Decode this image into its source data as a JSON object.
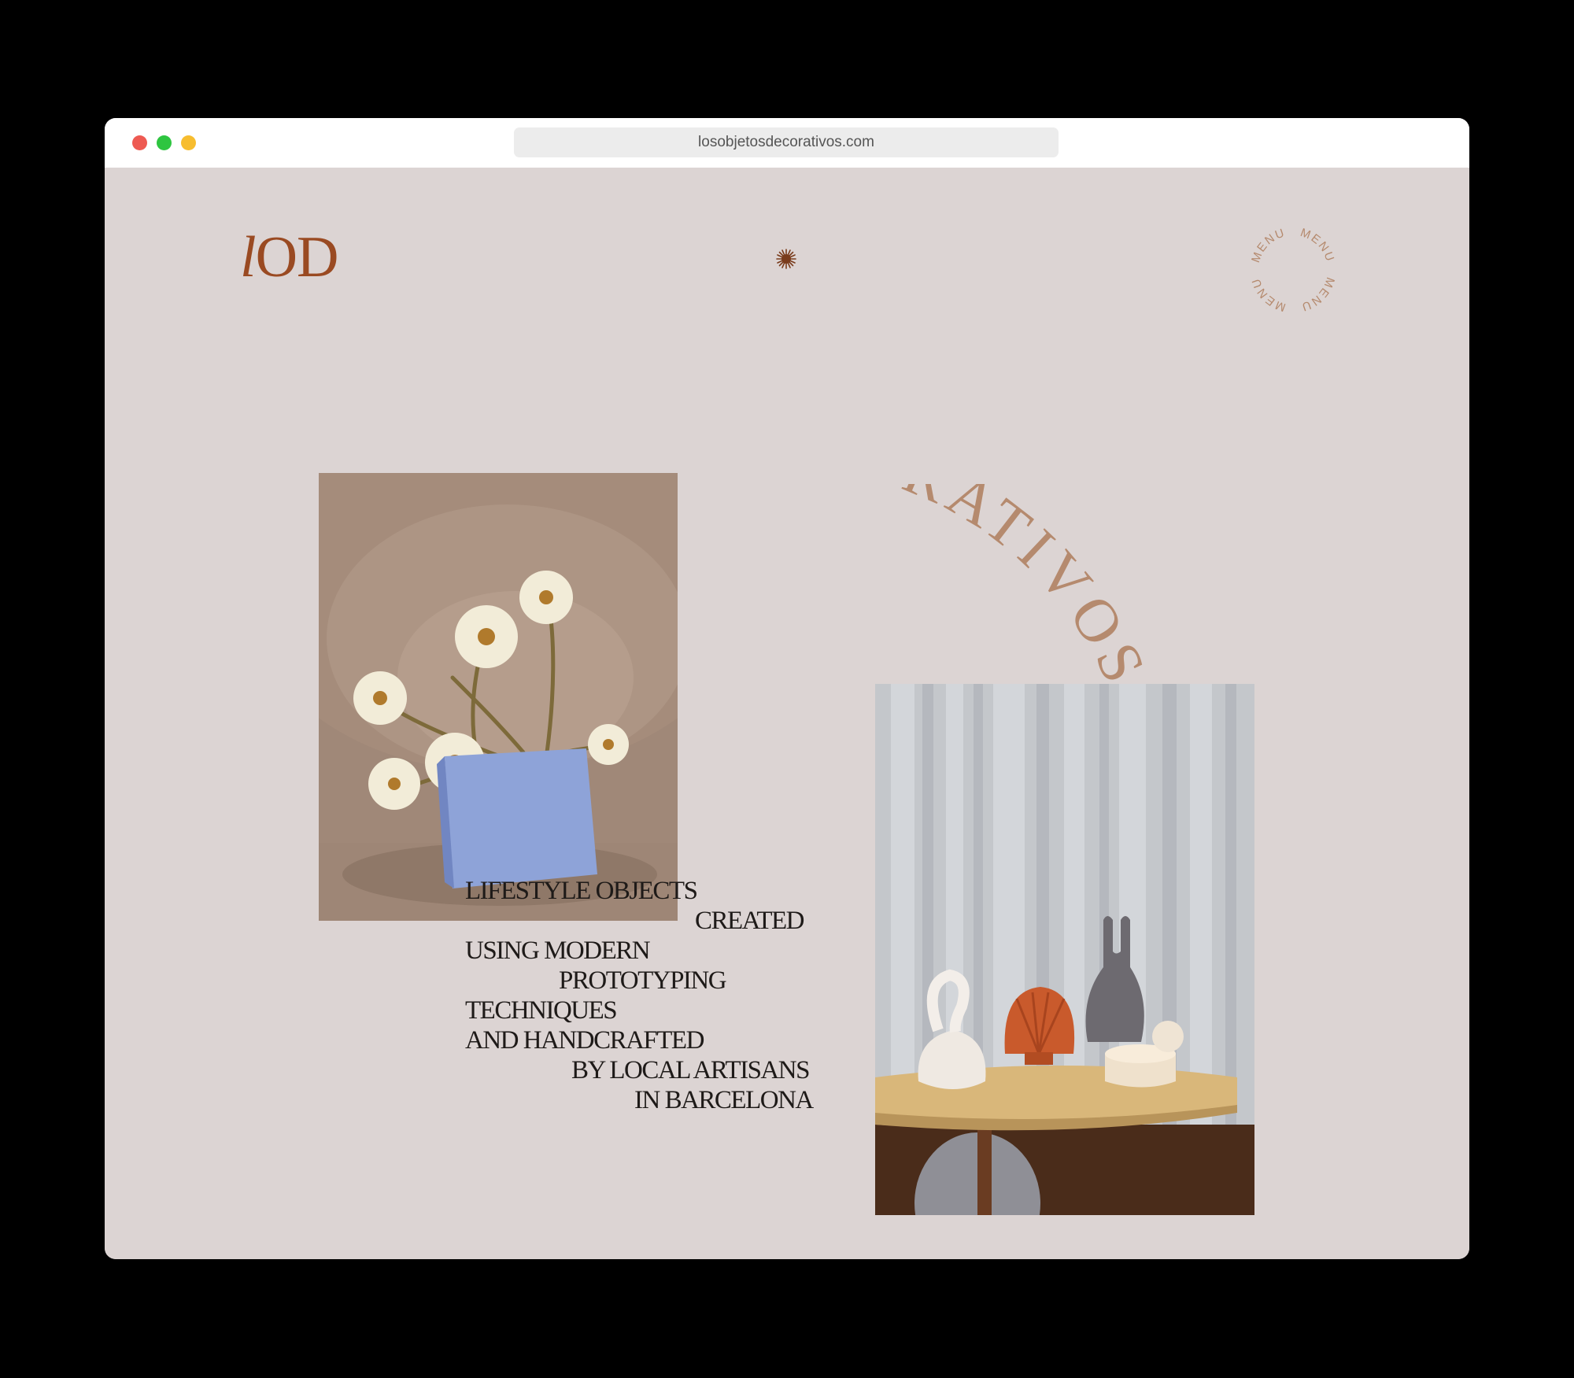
{
  "browser": {
    "url": "losobjetosdecorativos.com"
  },
  "site": {
    "logo": "lOD",
    "menu_label": "MENU",
    "arc_text": "LOS OBJETOS DECORATIVOS",
    "tagline": [
      "LIFESTYLE OBJECTS",
      "CREATED",
      "USING MODERN",
      "PROTOTYPING",
      "TECHNIQUES",
      "AND HANDCRAFTED",
      "BY LOCAL ARTISANS",
      "IN BARCELONA"
    ]
  },
  "colors": {
    "page_bg": "#dcd4d3",
    "logo": "#9a4a22",
    "accent": "#b58a6e",
    "text": "#1e1a18"
  }
}
